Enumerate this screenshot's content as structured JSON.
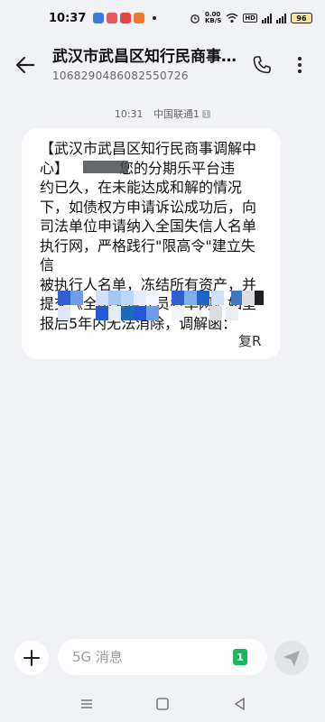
{
  "status_bar": {
    "time": "10:37",
    "net_speed_value": "0.00",
    "net_speed_unit": "KB/S",
    "battery": "96",
    "hd_label": "HD",
    "app_icon_colors": [
      "#3b7be0",
      "#e85a5a",
      "#e84545",
      "#f07a2a"
    ]
  },
  "header": {
    "title": "武汉市武昌区知行民商事…",
    "subtitle": "1068290486082550726",
    "icons": {
      "back": "arrow-left-icon",
      "call": "phone-icon",
      "more": "more-vertical-icon"
    }
  },
  "message": {
    "time": "10:31",
    "carrier": "中国联通1",
    "sim_badge": "1",
    "lines": [
      "【武汉市武昌区知行民商事调解中",
      "心】           您的分期乐平台违",
      "约已久，在未能达成和解的情况",
      "下，如债权方申请诉讼成功后，向",
      "司法单位申请纳入全国失信人名单",
      "执行网，严格践行\"限高令\"建立失信",
      "被执行人名单，冻结所有资产，并",
      "提交《全国失信人员名单网》如呈",
      "报后5年内无法消除，调解函："
    ],
    "ending_text": "复R"
  },
  "input": {
    "placeholder": "5G 消息",
    "sim_indicator": "1",
    "accent_color": "#17b85b"
  },
  "nav": {
    "icons": [
      "menu-icon",
      "home-square-icon",
      "back-triangle-icon"
    ]
  }
}
